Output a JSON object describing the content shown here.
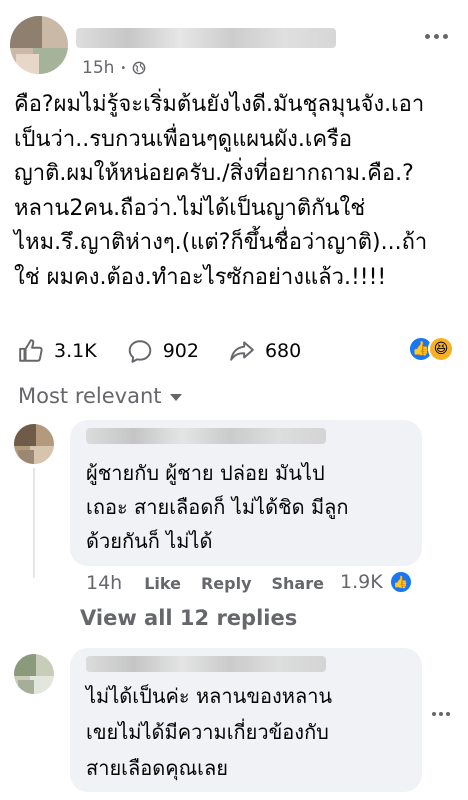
{
  "post": {
    "timestamp": "15h",
    "visibility_icon": "globe-icon",
    "text": "คือ?ผมไม่รู้จะเริ่มต้นยังไงดี.มันชุลมุนจัง.เอา\nเป็นว่า..รบกวนเพื่อนๆดูแผนผัง.เครือ\nญาติ.ผมให้หน่อยครับ./สิ่งที่อยากถาม.คือ.?\nหลาน2คน.ถือว่า.ไม่ได้เป็นญาติกันใช่\nไหม.รึ.ญาติห่างๆ.(แต่?ก็ขึ้นชื่อว่าญาติ)...ถ้า\nใช่ ผมคง.ต้อง.ทำอะไรซักอย่างแล้ว.!!!!"
  },
  "actions": {
    "like_count": "3.1K",
    "comment_count": "902",
    "share_count": "680"
  },
  "sort": {
    "label": "Most relevant"
  },
  "comments": [
    {
      "text": "ผู้ชายกับ ผู้ชาย ปล่อย มันไป\nเถอะ สายเลือดก็ ไม่ได้ชิด มีลูก\nด้วยกันก็ ไม่ได้",
      "timestamp": "14h",
      "like_label": "Like",
      "reply_label": "Reply",
      "share_label": "Share",
      "reactions": "1.9K"
    },
    {
      "text": "ไม่ได้เป็นค่ะ หลานของหลาน\nเขยไม่ได้มีความเกี่ยวข้องกับ\nสายเลือดคุณเลย"
    }
  ],
  "view_replies": {
    "label": "View all 12 replies"
  },
  "colors": {
    "meta": "#65676b",
    "bubble": "#f0f2f5",
    "like_blue": "#1877f2",
    "haha_yellow": "#f7b125"
  }
}
